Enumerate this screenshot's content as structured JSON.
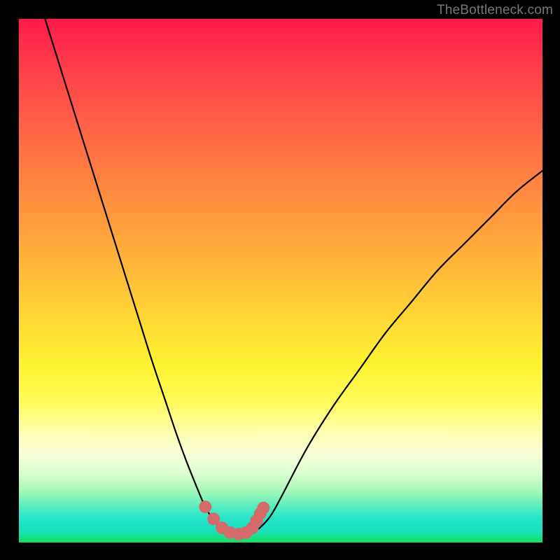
{
  "watermark": {
    "text": "TheBottleneck.com"
  },
  "chart_data": {
    "type": "line",
    "title": "",
    "xlabel": "",
    "ylabel": "",
    "xlim": [
      0,
      100
    ],
    "ylim": [
      0,
      100
    ],
    "grid": false,
    "legend": false,
    "annotations": [],
    "series": [
      {
        "name": "bottleneck-curve",
        "x": [
          5,
          10,
          15,
          20,
          25,
          28,
          30,
          32,
          34,
          35.5,
          37,
          38.5,
          40,
          41.5,
          43,
          44.5,
          46,
          48,
          50,
          55,
          60,
          65,
          70,
          75,
          80,
          85,
          90,
          95,
          100
        ],
        "values": [
          100,
          84,
          68,
          52,
          36,
          27,
          21,
          15.5,
          10.5,
          7,
          4.5,
          2.8,
          1.9,
          1.6,
          1.6,
          1.9,
          2.8,
          5,
          8.5,
          18,
          26,
          33,
          40,
          46,
          52,
          57,
          62,
          67,
          71
        ]
      }
    ],
    "highlight": {
      "name": "plateau-dots",
      "points": [
        {
          "x": 35.6,
          "y": 6.8
        },
        {
          "x": 37.2,
          "y": 4.5
        },
        {
          "x": 38.8,
          "y": 2.8
        },
        {
          "x": 40.3,
          "y": 1.9
        },
        {
          "x": 42.0,
          "y": 1.6
        },
        {
          "x": 43.4,
          "y": 1.9
        },
        {
          "x": 44.6,
          "y": 2.8
        },
        {
          "x": 45.4,
          "y": 4.2
        },
        {
          "x": 46.1,
          "y": 5.5
        },
        {
          "x": 46.7,
          "y": 6.6
        }
      ],
      "color": "#d56a6a",
      "radius": 9
    },
    "curve_style": {
      "color": "#000000",
      "width": 2.2
    }
  }
}
